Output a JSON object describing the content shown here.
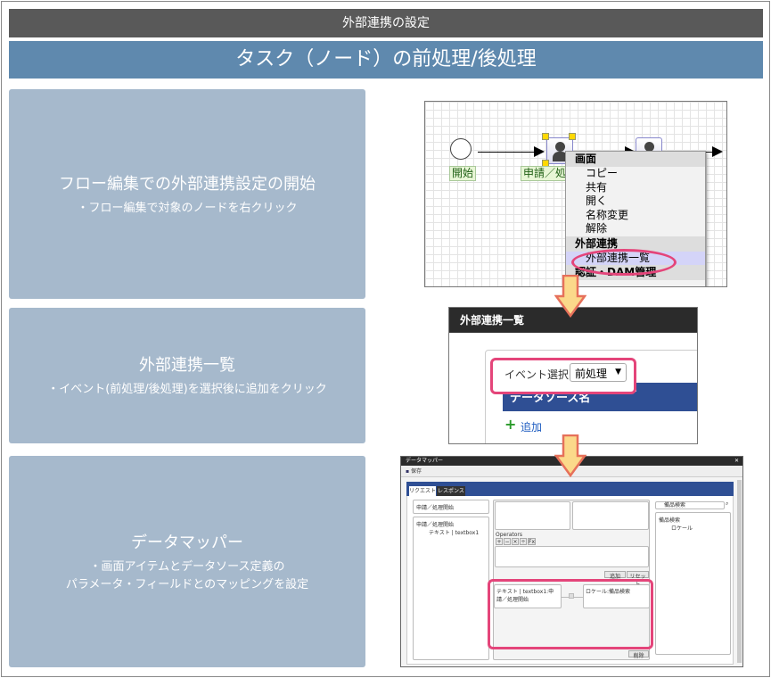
{
  "header": {
    "title": "外部連携の設定",
    "subtitle": "タスク（ノード）の前処理/後処理"
  },
  "steps": [
    {
      "heading": "フロー編集での外部連携設定の開始",
      "desc": [
        "・フロー編集で対象のノードを右クリック"
      ]
    },
    {
      "heading": "外部連携一覧",
      "desc": [
        "・イベント(前処理/後処理)を選択後に追加をクリック"
      ]
    },
    {
      "heading": "データマッパー",
      "desc": [
        "・画面アイテムとデータソース定義の",
        "パラメータ・フィールドとのマッピングを設定"
      ]
    }
  ],
  "flow": {
    "start_label": "開始",
    "node_label": "申請／処",
    "menu": {
      "section1": "画面",
      "items": [
        "コピー",
        "共有",
        "開く",
        "名称変更",
        "解除"
      ],
      "section2": "外部連携",
      "selected": "外部連携一覧",
      "section3": "認証・DAM管理"
    }
  },
  "integration_list": {
    "title": "外部連携一覧",
    "event_label": "イベント選択:",
    "event_value": "前処理",
    "column": "データソース名",
    "add_label": "追加"
  },
  "mapper": {
    "title": "データマッパー",
    "save": "保存",
    "tabs": [
      "リクエスト",
      "レスポンス"
    ],
    "left_title": "申請／処理開始",
    "left_tree_root": "申請／処理開始",
    "left_tree_child": "テキスト | textbox1",
    "operators_label": "Operators",
    "operators": [
      "+",
      "−",
      "×",
      "÷",
      "Fx"
    ],
    "add": "追加",
    "reset": "リセット",
    "delete": "削除",
    "map_source": "テキスト | textbox1:申請／処理開始",
    "map_target": "ロケール:備品検索",
    "search_value": "備品検索",
    "right_tree_root": "備品検索",
    "right_tree_child": "ロケール"
  },
  "colors": {
    "accent": "#5f89ae",
    "panel": "#a6b9cc",
    "highlight": "#e4457a",
    "arrow_fill": "#fbd98a",
    "arrow_stroke": "#e6705a"
  }
}
